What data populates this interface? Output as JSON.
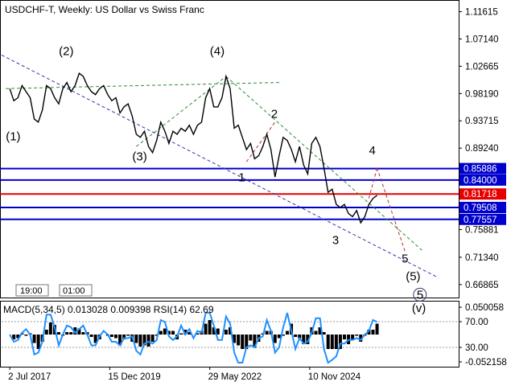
{
  "header": {
    "symbol": "USDCHF-T",
    "timeframe": "Weekly:",
    "description": "US Dollar vs Swiss Franc"
  },
  "chart_data": {
    "type": "line",
    "symbol": "USDCHF-T",
    "timeframe": "Weekly",
    "y_axis_ticks": [
      "1.11615",
      "1.07140",
      "1.02665",
      "0.98190",
      "0.93715",
      "0.89240",
      "0.75881",
      "0.71340",
      "0.66865"
    ],
    "ylim": [
      0.65,
      1.13
    ],
    "x_axis_ticks": [
      "2 Jul 2017",
      "15 Dec 2019",
      "29 May 2022",
      "10 Nov 2024"
    ],
    "price_levels": [
      {
        "label": "0.85886",
        "value": 0.85886,
        "color": "#0000cc"
      },
      {
        "label": "0.84000",
        "value": 0.84,
        "color": "#0000cc"
      },
      {
        "label": "0.81718",
        "value": 0.81718,
        "color": "#e60000"
      },
      {
        "label": "0.79508",
        "value": 0.79508,
        "color": "#0000cc"
      },
      {
        "label": "0.77557",
        "value": 0.77557,
        "color": "#0000cc"
      }
    ],
    "price_series": [
      [
        2017.5,
        0.99
      ],
      [
        2017.6,
        0.97
      ],
      [
        2017.7,
        0.975
      ],
      [
        2017.8,
        0.995
      ],
      [
        2017.9,
        0.985
      ],
      [
        2018.0,
        0.975
      ],
      [
        2018.1,
        0.94
      ],
      [
        2018.2,
        0.935
      ],
      [
        2018.3,
        0.955
      ],
      [
        2018.4,
        0.995
      ],
      [
        2018.5,
        0.99
      ],
      [
        2018.6,
        0.975
      ],
      [
        2018.7,
        0.965
      ],
      [
        2018.8,
        0.99
      ],
      [
        2018.9,
        1.0
      ],
      [
        2019.0,
        0.985
      ],
      [
        2019.1,
        0.995
      ],
      [
        2019.2,
        1.015
      ],
      [
        2019.3,
        1.01
      ],
      [
        2019.4,
        0.995
      ],
      [
        2019.5,
        0.985
      ],
      [
        2019.6,
        0.98
      ],
      [
        2019.7,
        0.99
      ],
      [
        2019.8,
        0.995
      ],
      [
        2019.9,
        0.98
      ],
      [
        2020.0,
        0.97
      ],
      [
        2020.1,
        0.975
      ],
      [
        2020.2,
        0.95
      ],
      [
        2020.3,
        0.96
      ],
      [
        2020.4,
        0.965
      ],
      [
        2020.5,
        0.945
      ],
      [
        2020.6,
        0.915
      ],
      [
        2020.7,
        0.91
      ],
      [
        2020.8,
        0.92
      ],
      [
        2020.9,
        0.895
      ],
      [
        2021.0,
        0.885
      ],
      [
        2021.1,
        0.905
      ],
      [
        2021.2,
        0.935
      ],
      [
        2021.3,
        0.92
      ],
      [
        2021.4,
        0.9
      ],
      [
        2021.5,
        0.92
      ],
      [
        2021.6,
        0.915
      ],
      [
        2021.7,
        0.925
      ],
      [
        2021.8,
        0.92
      ],
      [
        2021.9,
        0.93
      ],
      [
        2022.0,
        0.915
      ],
      [
        2022.1,
        0.93
      ],
      [
        2022.2,
        0.935
      ],
      [
        2022.3,
        0.975
      ],
      [
        2022.4,
        0.99
      ],
      [
        2022.5,
        0.96
      ],
      [
        2022.6,
        0.96
      ],
      [
        2022.7,
        0.975
      ],
      [
        2022.8,
        1.01
      ],
      [
        2022.9,
        0.99
      ],
      [
        2023.0,
        0.925
      ],
      [
        2023.1,
        0.93
      ],
      [
        2023.2,
        0.91
      ],
      [
        2023.3,
        0.89
      ],
      [
        2023.4,
        0.9
      ],
      [
        2023.5,
        0.875
      ],
      [
        2023.6,
        0.88
      ],
      [
        2023.7,
        0.895
      ],
      [
        2023.8,
        0.915
      ],
      [
        2023.9,
        0.89
      ],
      [
        2024.0,
        0.845
      ],
      [
        2024.1,
        0.88
      ],
      [
        2024.2,
        0.91
      ],
      [
        2024.3,
        0.905
      ],
      [
        2024.4,
        0.89
      ],
      [
        2024.5,
        0.87
      ],
      [
        2024.6,
        0.895
      ],
      [
        2024.7,
        0.865
      ],
      [
        2024.8,
        0.85
      ],
      [
        2024.9,
        0.9
      ],
      [
        2025.0,
        0.91
      ],
      [
        2025.1,
        0.895
      ],
      [
        2025.2,
        0.86
      ],
      [
        2025.3,
        0.82
      ],
      [
        2025.4,
        0.825
      ],
      [
        2025.5,
        0.8
      ],
      [
        2025.6,
        0.795
      ],
      [
        2025.7,
        0.8
      ],
      [
        2025.8,
        0.785
      ],
      [
        2025.9,
        0.78
      ],
      [
        2026.0,
        0.79
      ],
      [
        2026.1,
        0.77
      ],
      [
        2026.2,
        0.78
      ],
      [
        2026.3,
        0.8
      ],
      [
        2026.4,
        0.81
      ],
      [
        2026.5,
        0.815
      ]
    ],
    "wave_labels_green": [
      "(1)",
      "(2)",
      "(3)",
      "(4)",
      "(5)"
    ],
    "wave_labels_red": [
      "1",
      "2",
      "3",
      "4",
      "5"
    ],
    "wave_label_final": "(v)",
    "wave_label_final_circled": "5",
    "macd": {
      "label": "MACD(5,34,5) 0.013028 0.009398 RSI(14) 62.69",
      "y_axis_ticks": [
        "0.050058",
        "70.00",
        "30.00",
        "-0.052158"
      ]
    },
    "colors": {
      "support_resistance": "#0000cc",
      "pivot": "#e60000",
      "wave_green": "#2e8b2e",
      "wave_red": "#a83232",
      "rsi_line": "#1e90ff",
      "price_line": "#000000"
    },
    "grid": false
  },
  "toolbar": {
    "time_btn_1": "19:00",
    "time_btn_2": "01:00"
  }
}
